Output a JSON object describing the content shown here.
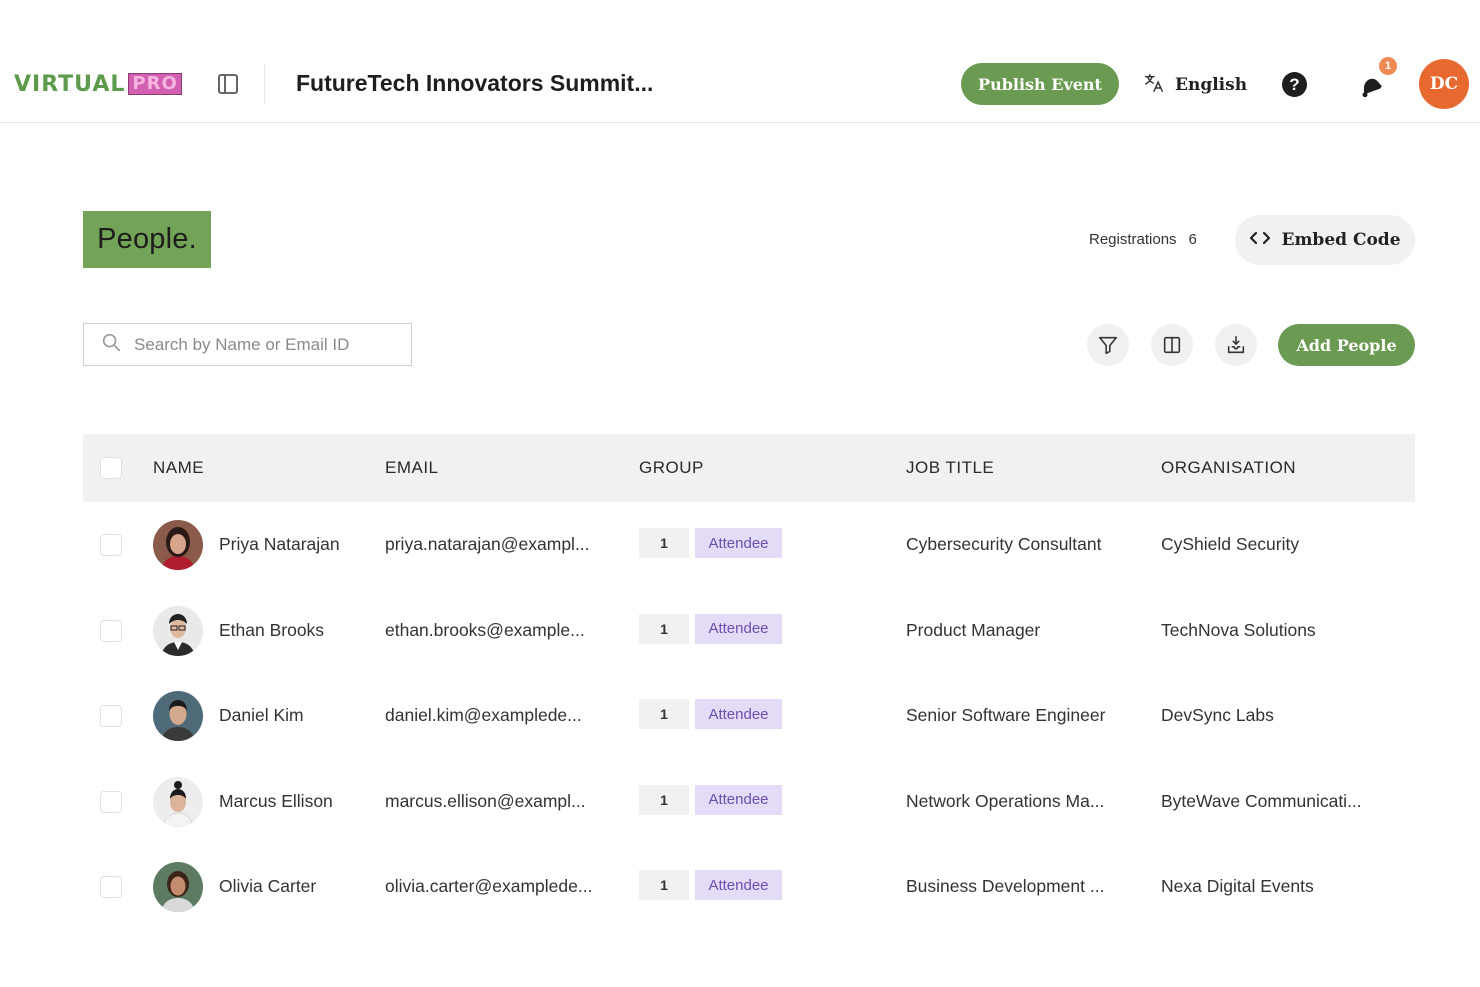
{
  "header": {
    "logo_part1": "VIRTUAL",
    "logo_part2": "PRO",
    "event_title": "FutureTech Innovators Summit...",
    "publish_label": "Publish Event",
    "language": "English",
    "help_glyph": "?",
    "notification_count": "1",
    "user_initials": "DC"
  },
  "page": {
    "title": "People.",
    "registrations_label": "Registrations",
    "registrations_count": "6",
    "embed_label": "Embed Code"
  },
  "toolbar": {
    "search_placeholder": "Search by Name or Email ID",
    "add_label": "Add People",
    "icons": [
      "filter-icon",
      "columns-icon",
      "export-icon"
    ]
  },
  "table": {
    "columns": [
      "NAME",
      "EMAIL",
      "GROUP",
      "JOB TITLE",
      "ORGANISATION"
    ],
    "rows": [
      {
        "name": "Priya Natarajan",
        "email": "priya.natarajan@exampl...",
        "group_count": "1",
        "group": "Attendee",
        "job_title": "Cybersecurity Consultant",
        "organisation": "CyShield Security"
      },
      {
        "name": "Ethan Brooks",
        "email": "ethan.brooks@example...",
        "group_count": "1",
        "group": "Attendee",
        "job_title": "Product Manager",
        "organisation": "TechNova Solutions"
      },
      {
        "name": "Daniel Kim",
        "email": "daniel.kim@examplede...",
        "group_count": "1",
        "group": "Attendee",
        "job_title": "Senior Software Engineer",
        "organisation": "DevSync Labs"
      },
      {
        "name": "Marcus Ellison",
        "email": "marcus.ellison@exampl...",
        "group_count": "1",
        "group": "Attendee",
        "job_title": "Network Operations Ma...",
        "organisation": "ByteWave Communicati..."
      },
      {
        "name": "Olivia Carter",
        "email": "olivia.carter@examplede...",
        "group_count": "1",
        "group": "Attendee",
        "job_title": "Business Development ...",
        "organisation": "Nexa Digital Events"
      }
    ]
  },
  "colors": {
    "brand_green": "#6b9a52",
    "title_green": "#72a356",
    "tag_purple_bg": "#e4dbf7",
    "tag_purple_text": "#6b4fb1",
    "avatar_orange": "#e8692f",
    "badge_orange": "#ee8a55"
  }
}
